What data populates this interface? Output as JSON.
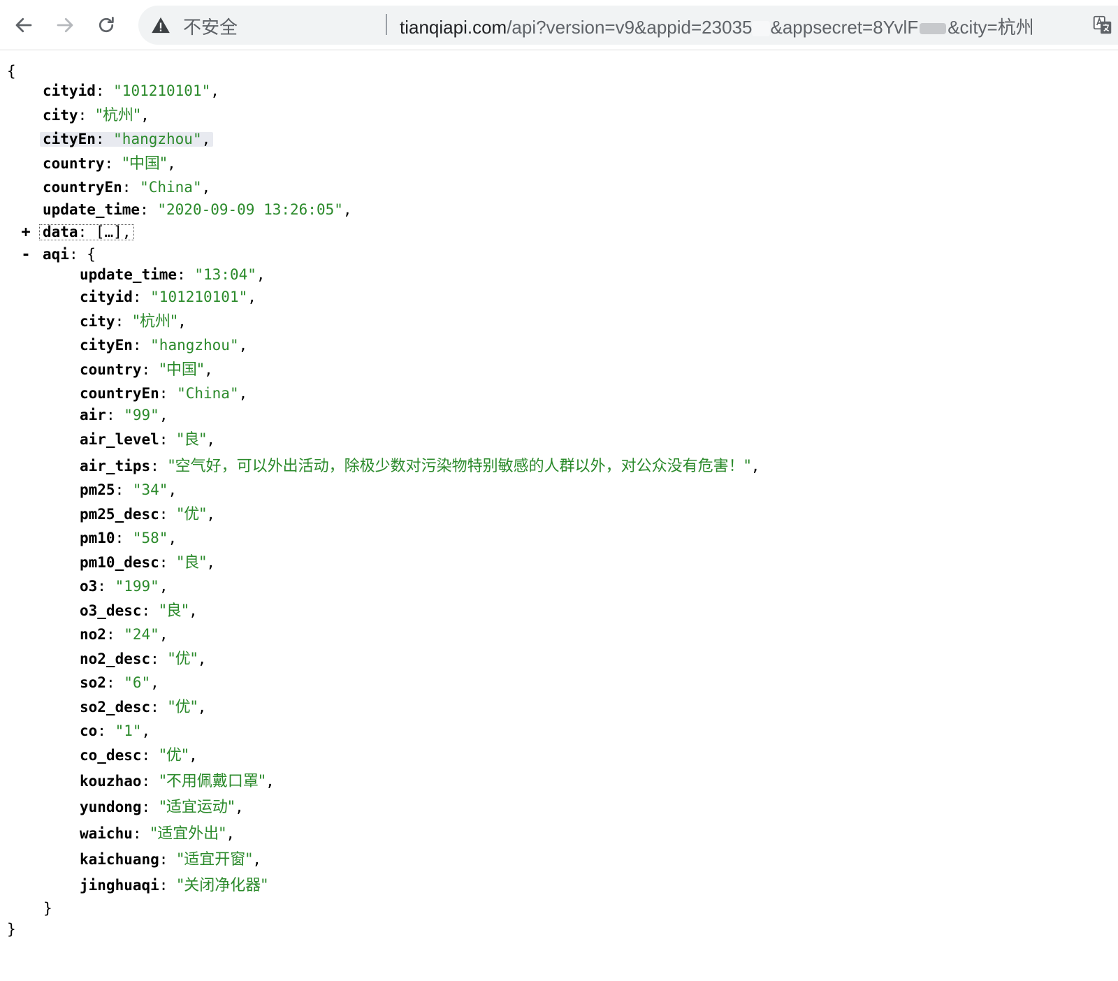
{
  "toolbar": {
    "security_label": "不安全",
    "url_host": "tianqiapi.com",
    "url_part1": "/api?version=v9&appid=23035",
    "url_part2": "&appsecret=8YvlF",
    "url_part3": "&city=杭州"
  },
  "json": {
    "open_brace": "{",
    "close_brace": "}",
    "inner_close": "}",
    "root": [
      {
        "key": "cityid",
        "value": "\"101210101\""
      },
      {
        "key": "city",
        "value": "\"杭州\""
      },
      {
        "key": "cityEn",
        "value": "\"hangzhou\""
      },
      {
        "key": "country",
        "value": "\"中国\""
      },
      {
        "key": "countryEn",
        "value": "\"China\""
      },
      {
        "key": "update_time",
        "value": "\"2020-09-09 13:26:05\""
      }
    ],
    "data_node": {
      "toggle": "+",
      "key": "data",
      "value": "[…]"
    },
    "aqi_node": {
      "toggle": "-",
      "key": "aqi",
      "open": "{"
    },
    "aqi": [
      {
        "key": "update_time",
        "value": "\"13:04\""
      },
      {
        "key": "cityid",
        "value": "\"101210101\""
      },
      {
        "key": "city",
        "value": "\"杭州\""
      },
      {
        "key": "cityEn",
        "value": "\"hangzhou\""
      },
      {
        "key": "country",
        "value": "\"中国\""
      },
      {
        "key": "countryEn",
        "value": "\"China\""
      },
      {
        "key": "air",
        "value": "\"99\""
      },
      {
        "key": "air_level",
        "value": "\"良\""
      },
      {
        "key": "air_tips",
        "value": "\"空气好，可以外出活动，除极少数对污染物特别敏感的人群以外，对公众没有危害！\""
      },
      {
        "key": "pm25",
        "value": "\"34\""
      },
      {
        "key": "pm25_desc",
        "value": "\"优\""
      },
      {
        "key": "pm10",
        "value": "\"58\""
      },
      {
        "key": "pm10_desc",
        "value": "\"良\""
      },
      {
        "key": "o3",
        "value": "\"199\""
      },
      {
        "key": "o3_desc",
        "value": "\"良\""
      },
      {
        "key": "no2",
        "value": "\"24\""
      },
      {
        "key": "no2_desc",
        "value": "\"优\""
      },
      {
        "key": "so2",
        "value": "\"6\""
      },
      {
        "key": "so2_desc",
        "value": "\"优\""
      },
      {
        "key": "co",
        "value": "\"1\""
      },
      {
        "key": "co_desc",
        "value": "\"优\""
      },
      {
        "key": "kouzhao",
        "value": "\"不用佩戴口罩\""
      },
      {
        "key": "yundong",
        "value": "\"适宜运动\""
      },
      {
        "key": "waichu",
        "value": "\"适宜外出\""
      },
      {
        "key": "kaichuang",
        "value": "\"适宜开窗\""
      },
      {
        "key": "jinghuaqi",
        "value": "\"关闭净化器\""
      }
    ]
  }
}
